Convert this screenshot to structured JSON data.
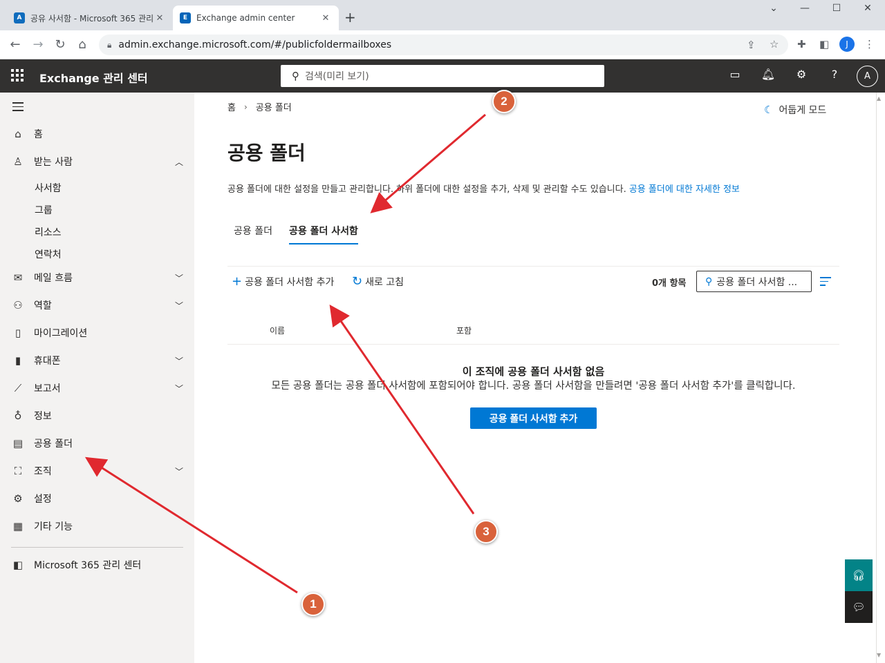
{
  "browser": {
    "tabs": [
      {
        "title": "공유 사서함 - Microsoft 365 관리",
        "favicon": "admin-logo-icon",
        "active": false
      },
      {
        "title": "Exchange admin center",
        "favicon": "exchange-logo-icon",
        "active": true
      }
    ],
    "url": "admin.exchange.microsoft.com/#/publicfoldermailboxes",
    "profile_initial": "J"
  },
  "header": {
    "app_name": "Exchange 관리 센터",
    "search_placeholder": "검색(미리 보기)",
    "avatar_initial": "A"
  },
  "sidebar": {
    "items": [
      {
        "label": "홈",
        "icon": "home-icon"
      },
      {
        "label": "받는 사람",
        "icon": "person-icon",
        "expanded": true,
        "children": [
          "사서함",
          "그룹",
          "리소스",
          "연락처"
        ]
      },
      {
        "label": "메일 흐름",
        "icon": "mail-icon"
      },
      {
        "label": "역할",
        "icon": "roles-icon"
      },
      {
        "label": "마이그레이션",
        "icon": "migration-icon"
      },
      {
        "label": "휴대폰",
        "icon": "mobile-icon"
      },
      {
        "label": "보고서",
        "icon": "reports-icon"
      },
      {
        "label": "정보",
        "icon": "lightbulb-icon"
      },
      {
        "label": "공용 폴더",
        "icon": "public-folder-icon"
      },
      {
        "label": "조직",
        "icon": "org-icon"
      },
      {
        "label": "설정",
        "icon": "gear-icon"
      },
      {
        "label": "기타 기능",
        "icon": "table-icon"
      }
    ],
    "footer_link": "Microsoft 365 관리 센터"
  },
  "main": {
    "breadcrumb": [
      "홈",
      "공용 폴더"
    ],
    "dark_mode_label": "어둡게 모드",
    "title": "공용 폴더",
    "description": "공용 폴더에 대한 설정을 만들고 관리합니다. 하위 폴더에 대한 설정을 추가, 삭제 및 관리할 수도 있습니다.",
    "learn_more_link": "공용 폴더에 대한 자세한 정보",
    "tabs": [
      {
        "label": "공용 폴더",
        "selected": false
      },
      {
        "label": "공용 폴더 사서함",
        "selected": true
      }
    ],
    "commands": {
      "add_label": "공용 폴더 사서함 추가",
      "refresh_label": "새로 고침"
    },
    "item_count": "0개 항목",
    "filter_placeholder": "공용 폴더 사서함 ...",
    "columns": [
      "이름",
      "포함"
    ],
    "empty_state": {
      "title": "이 조직에 공용 폴더 사서함 없음",
      "description": "모든 공용 폴더는 공용 폴더 사서함에 포함되어야 합니다. 공용 폴더 사서함을 만들려면 '공용 폴더 사서함 추가'를 클릭합니다.",
      "button_label": "공용 폴더 사서함 추가"
    }
  },
  "annotations": {
    "markers": [
      "1",
      "2",
      "3"
    ],
    "color": "#e0292f"
  },
  "colors": {
    "accent": "#0078d4",
    "header_bg": "#323130",
    "sidebar_bg": "#f3f2f1"
  }
}
